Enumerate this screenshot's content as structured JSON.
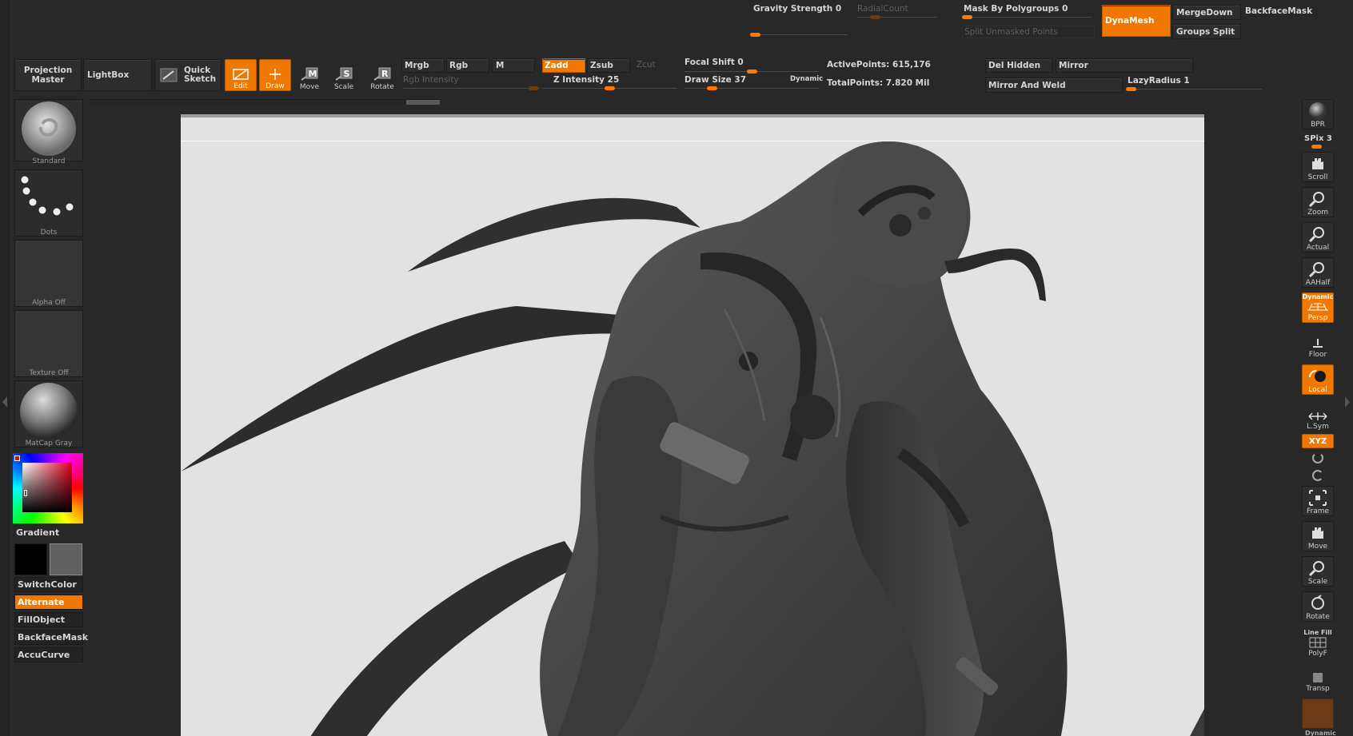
{
  "top_row1": {
    "gravity_strength": "Gravity Strength 0",
    "radial_count": "RadialCount",
    "mask_by_polygroups": "Mask By Polygroups 0",
    "split_unmasked": "Split Unmasked Points",
    "dynamesh": "DynaMesh",
    "merge_down": "MergeDown",
    "backface_mask": "BackfaceMask",
    "groups_split": "Groups Split"
  },
  "top_row2": {
    "projection_master": [
      "Projection",
      "Master"
    ],
    "lightbox": "LightBox",
    "quick_sketch": [
      "Quick",
      "Sketch"
    ],
    "tools": {
      "edit": "Edit",
      "draw": "Draw",
      "move": "Move",
      "scale": "Scale",
      "rotate": "Rotate"
    },
    "mrgb": "Mrgb",
    "rgb": "Rgb",
    "m": "M",
    "zadd": "Zadd",
    "zsub": "Zsub",
    "zcut": "Zcut",
    "rgb_intensity": "Rgb Intensity",
    "z_intensity": "Z Intensity 25",
    "focal_shift": "Focal Shift 0",
    "draw_size": "Draw Size 37",
    "dynamic": "Dynamic",
    "active_points": "ActivePoints: 615,176",
    "total_points": "TotalPoints: 7.820 Mil",
    "del_hidden": "Del Hidden",
    "mirror": "Mirror",
    "mirror_and_weld": "Mirror And Weld",
    "lazy_radius": "LazyRadius 1"
  },
  "left_panel": {
    "brush": "Standard",
    "stroke": "Dots",
    "alpha": "Alpha  Off",
    "texture": "Texture  Off",
    "material": "MatCap  Gray",
    "gradient": "Gradient",
    "switch_color": "SwitchColor",
    "alternate": "Alternate",
    "fill_object": "FillObject",
    "backface_mask": "BackfaceMask",
    "accucurve": "AccuCurve"
  },
  "right_shelf": {
    "bpr": "BPR",
    "spix": "SPix 3",
    "scroll": "Scroll",
    "zoom": "Zoom",
    "actual": "Actual",
    "aahalf": "AAHalf",
    "dynamic": "Dynamic",
    "persp": "Persp",
    "floor": "Floor",
    "local": "Local",
    "lsym": "L.Sym",
    "xyz": "XYZ",
    "frame": "Frame",
    "move": "Move",
    "scale": "Scale",
    "rotate": "Rotate",
    "line_fill": "Line Fill",
    "polyf": "PolyF",
    "transp": "Transp",
    "dynamic_bottom": "Dynamic"
  },
  "slider_levels": {
    "gravity_strength": 0,
    "focal_shift": 0,
    "z_intensity": 25,
    "draw_size": 37,
    "spix": 3,
    "lazy_radius": 1
  },
  "colors": {
    "accent": "#f07800",
    "canvas": "#e2e2e2",
    "model": "#3c3c3c",
    "ui_bg": "#282828"
  }
}
